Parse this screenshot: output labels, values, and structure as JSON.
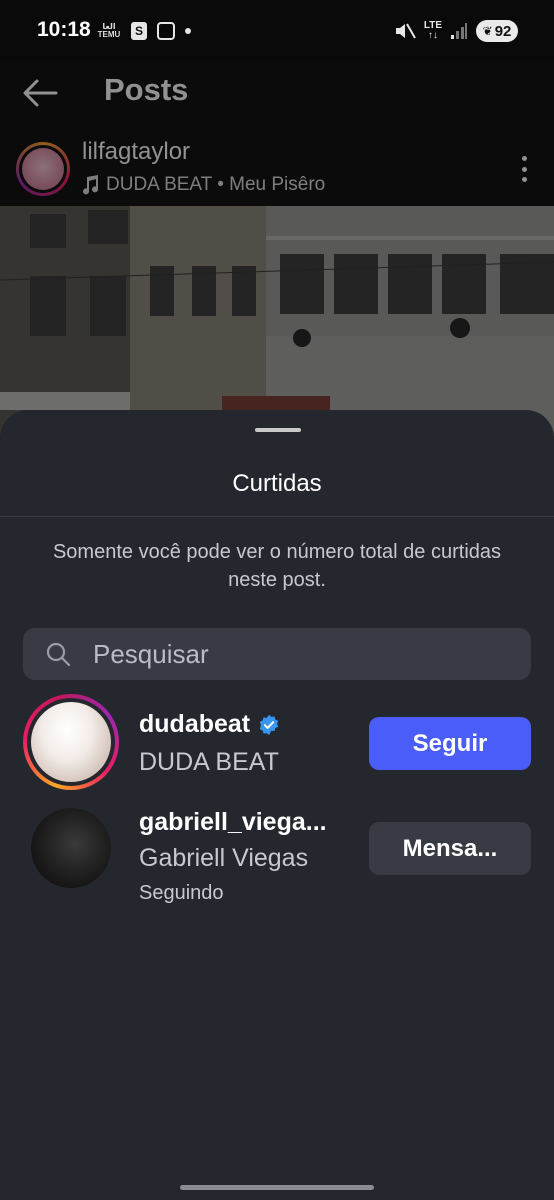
{
  "status_bar": {
    "time": "10:18",
    "temu_top": "العا",
    "temu_bottom": "TEMU",
    "shop_letter": "S",
    "network": "LTE",
    "battery": "92"
  },
  "header": {
    "title": "Posts"
  },
  "post": {
    "author": "lilfagtaylor",
    "music": "DUDA BEAT • Meu Pisêro"
  },
  "sheet": {
    "title": "Curtidas",
    "info": "Somente você pode ver o número total de curtidas neste post.",
    "search_placeholder": "Pesquisar"
  },
  "likes": [
    {
      "username": "dudabeat",
      "verified": true,
      "full_name": "DUDA BEAT",
      "subtext": "",
      "action_label": "Seguir"
    },
    {
      "username": "gabriell_viega...",
      "verified": false,
      "full_name": "Gabriell Viegas",
      "subtext": "Seguindo",
      "action_label": "Mensa..."
    }
  ],
  "colors": {
    "sheet_bg": "#25272e",
    "follow_button": "#4a5df9",
    "secondary_button": "#383b44",
    "verified_badge": "#3797f0"
  }
}
